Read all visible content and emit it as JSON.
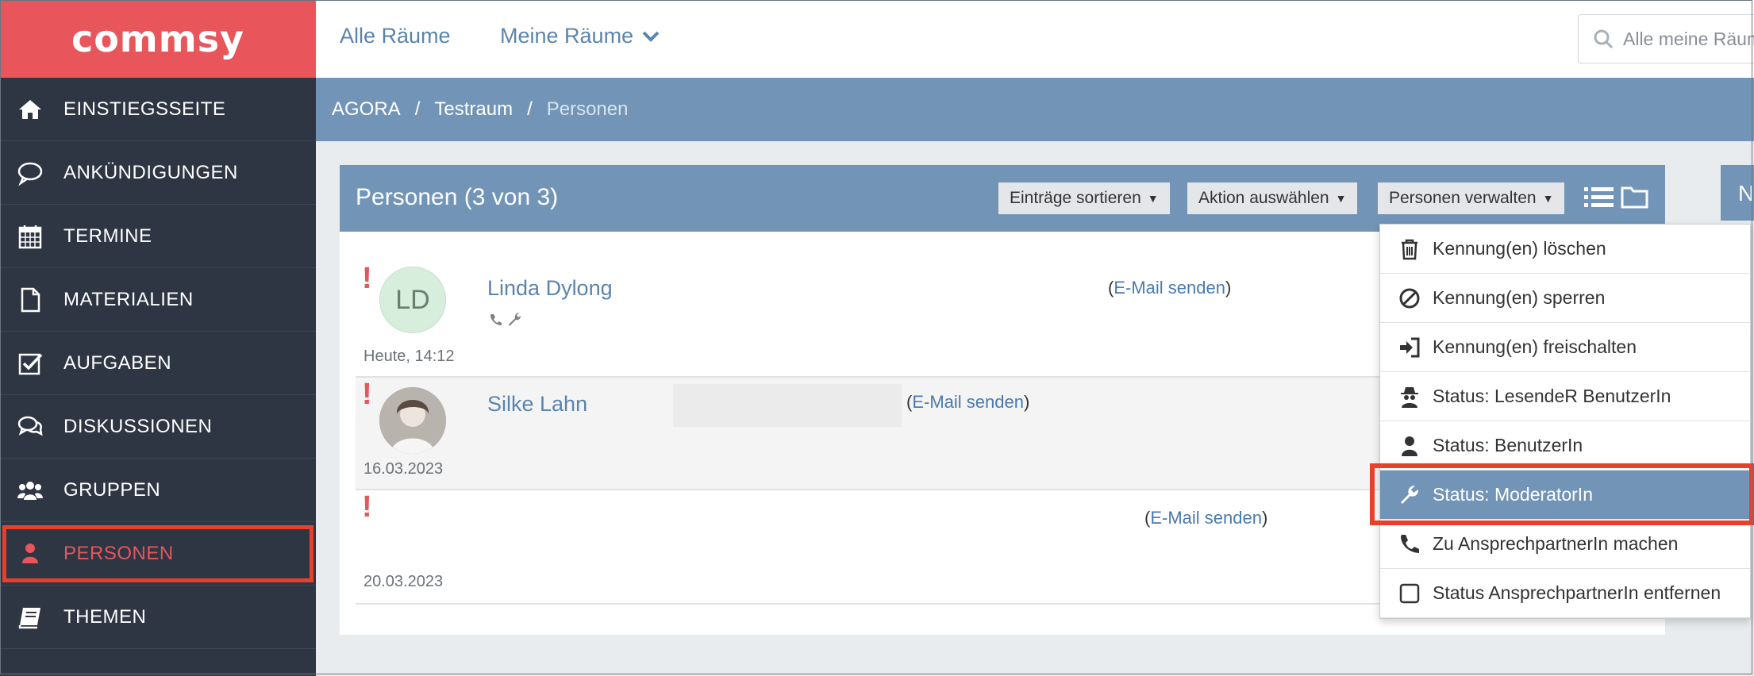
{
  "app": {
    "logo_text": "commsy"
  },
  "topbar": {
    "all_rooms": "Alle Räume",
    "my_rooms": "Meine Räume",
    "search_placeholder": "Alle meine Räume"
  },
  "breadcrumb": {
    "items": [
      "AGORA",
      "Testraum",
      "Personen"
    ]
  },
  "sidebar": {
    "items": [
      {
        "label": "EINSTIEGSSEITE",
        "icon": "home-icon"
      },
      {
        "label": "ANKÜNDIGUNGEN",
        "icon": "speech-bubble-icon"
      },
      {
        "label": "TERMINE",
        "icon": "calendar-icon"
      },
      {
        "label": "MATERIALIEN",
        "icon": "document-icon"
      },
      {
        "label": "AUFGABEN",
        "icon": "checkbox-icon"
      },
      {
        "label": "DISKUSSIONEN",
        "icon": "discussion-icon"
      },
      {
        "label": "GRUPPEN",
        "icon": "group-icon"
      },
      {
        "label": "PERSONEN",
        "icon": "person-icon",
        "active": true
      },
      {
        "label": "THEMEN",
        "icon": "book-icon"
      }
    ]
  },
  "panel": {
    "title": "Personen (3 von 3)",
    "sort_label": "Einträge sortieren",
    "action_label": "Aktion auswählen",
    "manage_label": "Personen verwalten",
    "side_panel_initial": "N"
  },
  "entries": [
    {
      "initials": "LD",
      "name": "Linda Dylong",
      "date": "Heute, 14:12",
      "email_link": "E-Mail senden"
    },
    {
      "initials": "",
      "name": "Silke Lahn",
      "date": "16.03.2023",
      "email_link": "E-Mail senden"
    },
    {
      "initials": "",
      "name": "",
      "date": "20.03.2023",
      "email_link": "E-Mail senden"
    }
  ],
  "dropdown": {
    "items": [
      {
        "label": "Kennung(en) löschen",
        "icon": "trash-icon"
      },
      {
        "label": "Kennung(en) sperren",
        "icon": "ban-icon"
      },
      {
        "label": "Kennung(en) freischalten",
        "icon": "sign-in-icon"
      },
      {
        "label": "Status: LesendeR BenutzerIn",
        "icon": "spy-icon"
      },
      {
        "label": "Status: BenutzerIn",
        "icon": "user-icon"
      },
      {
        "label": "Status: ModeratorIn",
        "icon": "wrench-icon",
        "selected": true
      },
      {
        "label": "Zu AnsprechpartnerIn machen",
        "icon": "phone-icon"
      },
      {
        "label": "Status AnsprechpartnerIn entfernen",
        "icon": "square-icon"
      }
    ]
  },
  "colors": {
    "sidebar_bg": "#2e3543",
    "logo_bg": "#e8555b",
    "accent_blue": "#7295b7",
    "link_blue": "#5b84ad",
    "highlight_red": "#e8402a"
  }
}
